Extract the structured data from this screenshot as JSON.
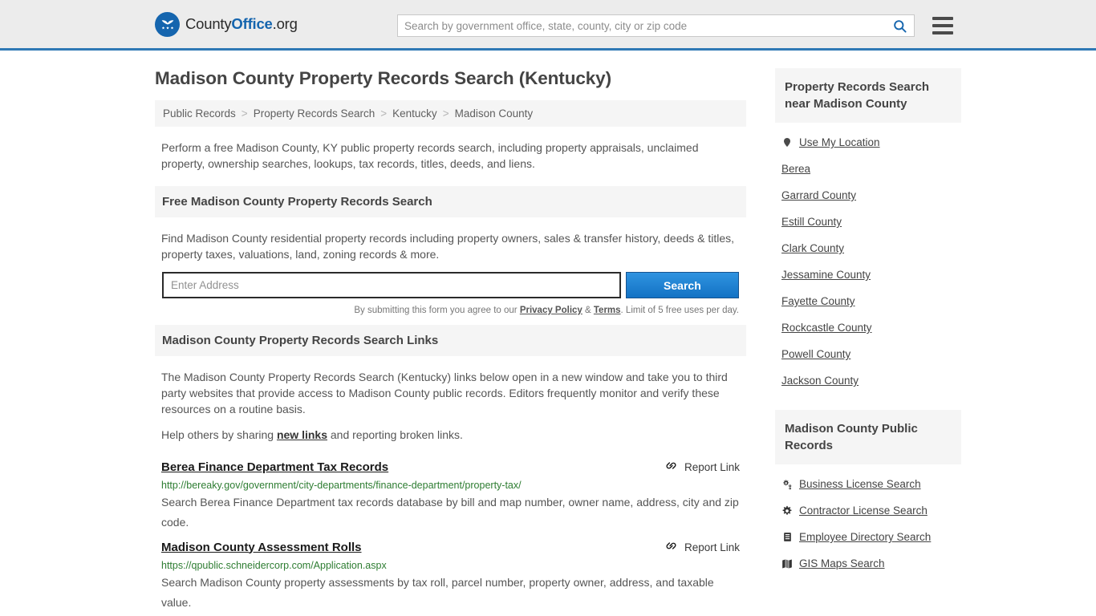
{
  "header": {
    "logo": {
      "icon": "eagle-shield-logo-icon",
      "part1": "County",
      "part2": "Office",
      "part3": ".org"
    },
    "search_placeholder": "Search by government office, state, county, city or zip code",
    "search_value": "",
    "search_icon": "search-icon",
    "menu_icon": "hamburger-menu-icon"
  },
  "main": {
    "title": "Madison County Property Records Search (Kentucky)",
    "breadcrumb": [
      "Public Records",
      "Property Records Search",
      "Kentucky",
      "Madison County"
    ],
    "breadcrumb_separator": ">",
    "intro": "Perform a free Madison County, KY public property records search, including property appraisals, unclaimed property, ownership searches, lookups, tax records, titles, deeds, and liens.",
    "free_search": {
      "heading": "Free Madison County Property Records Search",
      "description": "Find Madison County residential property records including property owners, sales & transfer history, deeds & titles, property taxes, valuations, land, zoning records & more.",
      "input_placeholder": "Enter Address",
      "input_value": "",
      "button_label": "Search",
      "note_prefix": "By submitting this form you agree to our ",
      "note_privacy": "Privacy Policy",
      "note_amp": " & ",
      "note_terms": "Terms",
      "note_suffix": ". Limit of 5 free uses per day."
    },
    "links_section": {
      "heading": "Madison County Property Records Search Links",
      "paragraph1": "The Madison County Property Records Search (Kentucky) links below open in a new window and take you to third party websites that provide access to Madison County public records. Editors frequently monitor and verify these resources on a routine basis.",
      "paragraph2_prefix": "Help others by sharing ",
      "paragraph2_link": "new links",
      "paragraph2_suffix": " and reporting broken links.",
      "report_label": "Report Link",
      "report_icon": "broken-link-icon",
      "items": [
        {
          "title": "Berea Finance Department Tax Records",
          "url": "http://bereaky.gov/government/city-departments/finance-department/property-tax/",
          "description": "Search Berea Finance Department tax records database by bill and map number, owner name, address, city and zip code."
        },
        {
          "title": "Madison County Assessment Rolls",
          "url": "https://qpublic.schneidercorp.com/Application.aspx",
          "description": "Search Madison County property assessments by tax roll, parcel number, property owner, address, and taxable value."
        }
      ]
    }
  },
  "sidebar": {
    "near_panel": {
      "heading": "Property Records Search near Madison County",
      "items": [
        {
          "label": "Use My Location",
          "icon": "map-pin-icon"
        },
        {
          "label": "Berea",
          "icon": ""
        },
        {
          "label": "Garrard County",
          "icon": ""
        },
        {
          "label": "Estill County",
          "icon": ""
        },
        {
          "label": "Clark County",
          "icon": ""
        },
        {
          "label": "Jessamine County",
          "icon": ""
        },
        {
          "label": "Fayette County",
          "icon": ""
        },
        {
          "label": "Rockcastle County",
          "icon": ""
        },
        {
          "label": "Powell County",
          "icon": ""
        },
        {
          "label": "Jackson County",
          "icon": ""
        }
      ]
    },
    "public_records_panel": {
      "heading": "Madison County Public Records",
      "items": [
        {
          "label": "Business License Search",
          "icon": "gears-icon"
        },
        {
          "label": "Contractor License Search",
          "icon": "gear-icon"
        },
        {
          "label": "Employee Directory Search",
          "icon": "document-list-icon"
        },
        {
          "label": "GIS Maps Search",
          "icon": "map-book-icon"
        }
      ]
    }
  },
  "colors": {
    "brand_blue": "#1565ae",
    "header_bg": "#ececec",
    "header_border": "#2f78b5",
    "panel_bg": "#f5f5f5",
    "button_blue": "#1372c4",
    "url_green": "#2e7d32"
  }
}
